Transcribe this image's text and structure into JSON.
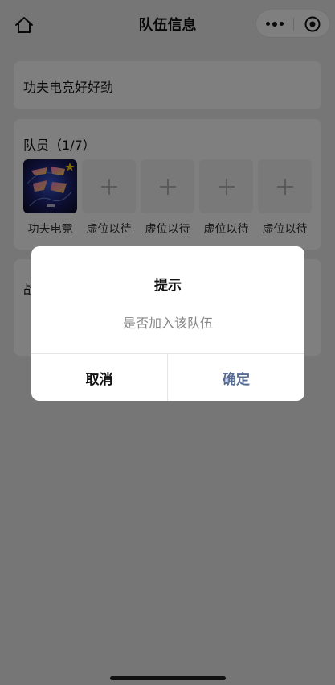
{
  "navbar": {
    "title": "队伍信息",
    "home_icon": "home-icon",
    "more_icon": "more-dots-icon",
    "close_icon": "target-circle-icon"
  },
  "team": {
    "name": "功夫电竞好好劲"
  },
  "members": {
    "title": "队员（1/7）",
    "slots": [
      {
        "label": "功夫电竞",
        "type": "avatar",
        "avatar_text": "功夫电竞"
      },
      {
        "label": "虚位以待",
        "type": "empty",
        "icon": "plus-icon"
      },
      {
        "label": "虚位以待",
        "type": "empty",
        "icon": "plus-icon"
      },
      {
        "label": "虚位以待",
        "type": "empty",
        "icon": "plus-icon"
      },
      {
        "label": "虚位以待",
        "type": "empty",
        "icon": "plus-icon"
      }
    ]
  },
  "battle": {
    "title": "战"
  },
  "dialog": {
    "title": "提示",
    "message": "是否加入该队伍",
    "cancel_label": "取消",
    "confirm_label": "确定"
  },
  "colors": {
    "confirm": "#576b95",
    "mask": "rgba(0,0,0,0.5)"
  }
}
